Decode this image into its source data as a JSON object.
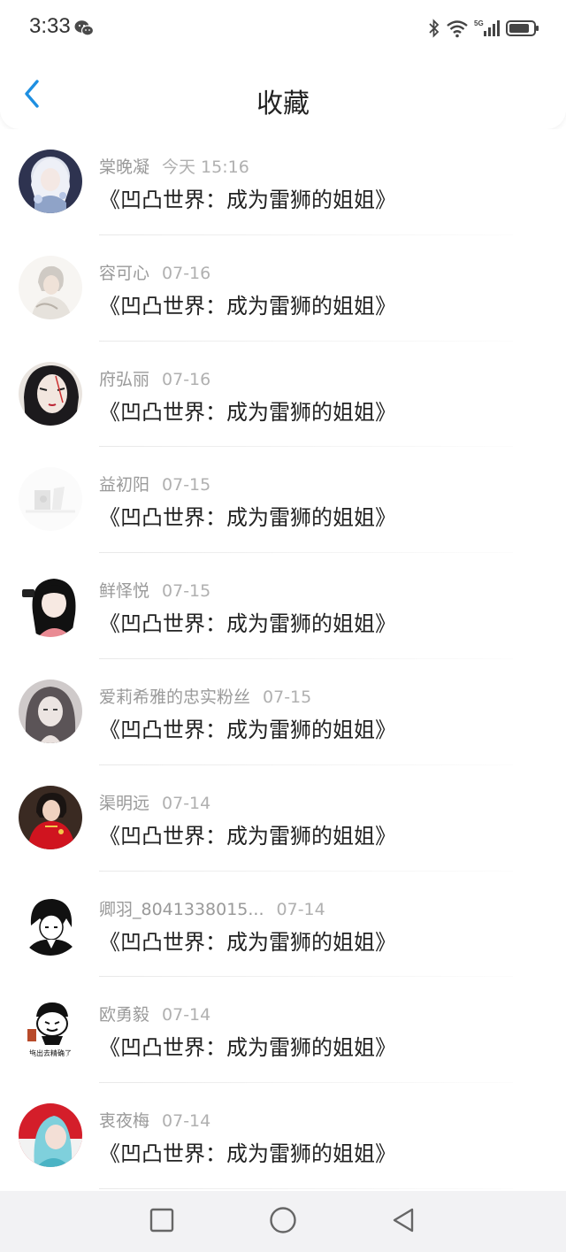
{
  "status_bar": {
    "time": "3:33",
    "icons": [
      "wechat-icon",
      "bluetooth-icon",
      "wifi-icon",
      "5g-signal-icon",
      "battery-icon"
    ],
    "network_label": "5G"
  },
  "header": {
    "title": "收藏",
    "back_icon": "chevron-left-icon",
    "accent_color": "#1e8fe1"
  },
  "favorites": [
    {
      "user": "棠晚凝",
      "date": "今天 15:16",
      "title": "《凹凸世界：成为雷狮的姐姐》",
      "avatar": "avatar-white-haired-girl"
    },
    {
      "user": "容可心",
      "date": "07-16",
      "title": "《凹凸世界：成为雷狮的姐姐》",
      "avatar": "avatar-grey-haired-boy"
    },
    {
      "user": "府弘丽",
      "date": "07-16",
      "title": "《凹凸世界：成为雷狮的姐姐》",
      "avatar": "avatar-dark-haired-face"
    },
    {
      "user": "益初阳",
      "date": "07-15",
      "title": "《凹凸世界：成为雷狮的姐姐》",
      "avatar": "avatar-faded-grey"
    },
    {
      "user": "鲜怿悦",
      "date": "07-15",
      "title": "《凹凸世界：成为雷狮的姐姐》",
      "avatar": "avatar-black-hair-girl"
    },
    {
      "user": "爱莉希雅的忠实粉丝",
      "date": "07-15",
      "title": "《凹凸世界：成为雷狮的姐姐》",
      "avatar": "avatar-sketch-girl"
    },
    {
      "user": "渠明远",
      "date": "07-14",
      "title": "《凹凸世界：成为雷狮的姐姐》",
      "avatar": "avatar-red-qipao-woman"
    },
    {
      "user": "卿羽_8041338015...",
      "date": "07-14",
      "title": "《凹凸世界：成为雷狮的姐姐》",
      "avatar": "avatar-monochrome-boy"
    },
    {
      "user": "欧勇毅",
      "date": "07-14",
      "title": "《凹凸世界：成为雷狮的姐姐》",
      "avatar": "avatar-meme-cartoon",
      "avatar_caption": "拖出去精确了"
    },
    {
      "user": "衷夜梅",
      "date": "07-14",
      "title": "《凹凸世界：成为雷狮的姐姐》",
      "avatar": "avatar-red-blue-girl"
    }
  ],
  "system_nav": {
    "buttons": [
      "recents-square-icon",
      "home-circle-icon",
      "back-triangle-icon"
    ]
  }
}
